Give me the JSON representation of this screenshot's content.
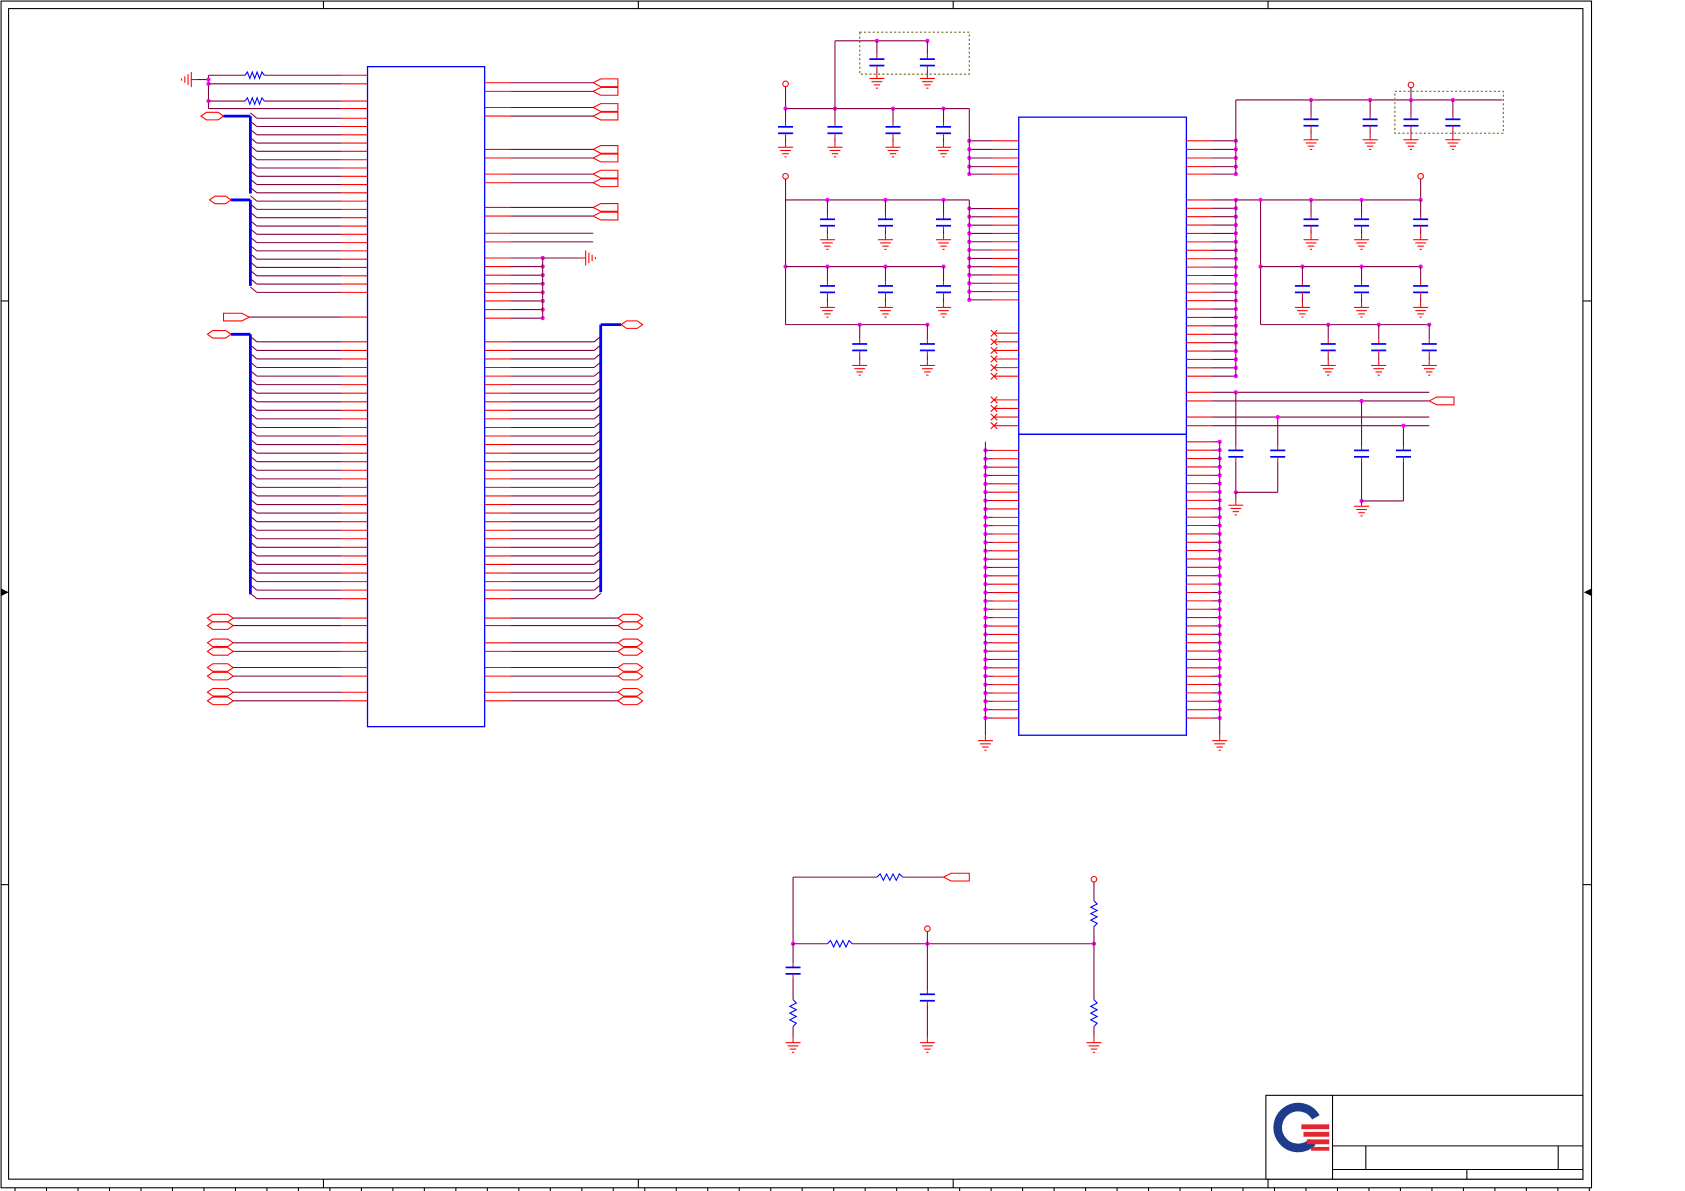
{
  "colors": {
    "wire": "#800040",
    "pin": "#ff0000",
    "part": "#0000ff",
    "bus": "#0000ff",
    "junction": "#ff00ff",
    "frame": "#000000",
    "keepout": "#808040",
    "logo_blue": "#1e3c8c",
    "logo_red": "#e3262f"
  },
  "icons": {
    "ground": "ground-icon",
    "power": "power-icon",
    "capacitor": "capacitor-icon",
    "resistor": "resistor-icon",
    "offpage": "off-page-connector-icon",
    "noconnect": "no-connect-icon",
    "logo": "company-logo-icon"
  }
}
